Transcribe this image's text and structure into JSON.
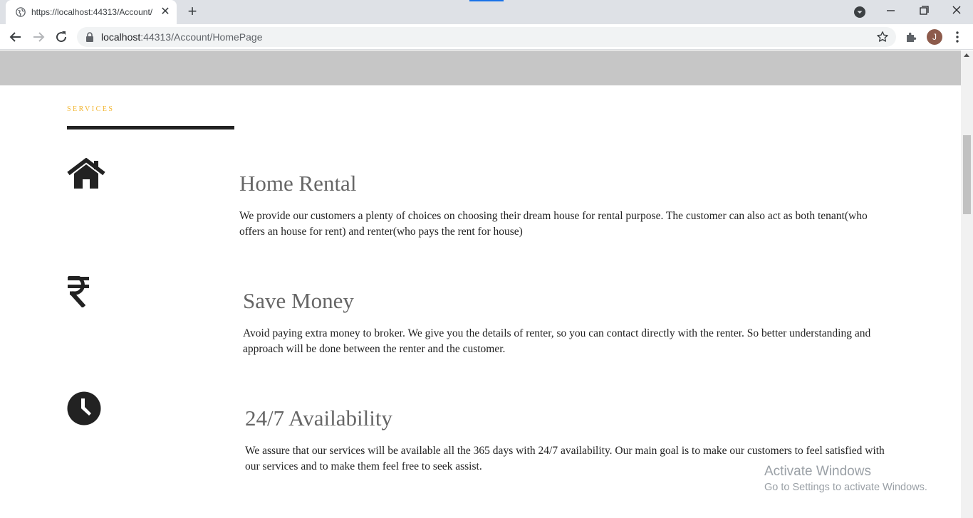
{
  "browser": {
    "tab_title": "https://localhost:44313/Account/",
    "tab_close": "✕",
    "new_tab": "+",
    "avatar_initial": "J",
    "url_host": "localhost",
    "url_rest": ":44313/Account/HomePage"
  },
  "page": {
    "section_label": "SERVICES",
    "services": [
      {
        "icon": "home-icon",
        "title": "Home Rental",
        "description": "We provide our customers a plenty of choices on choosing their dream house for rental purpose. The customer can also act as both tenant(who offers an house for rent) and renter(who pays the rent for house)"
      },
      {
        "icon": "rupee-icon",
        "title": "Save Money",
        "description": "Avoid paying extra money to broker. We give you the details of renter, so you can contact directly with the renter. So better understanding and approach will be done between the renter and the customer."
      },
      {
        "icon": "clock-icon",
        "title": "24/7 Availability",
        "description": "We assure that our services will be available all the 365 days with 24/7 availability. Our main goal is to make our customers to feel satisfied with our services and to make them feel free to seek assist."
      }
    ]
  },
  "watermark": {
    "title": "Activate Windows",
    "subtitle": "Go to Settings to activate Windows."
  },
  "colors": {
    "accent": "#f2b632",
    "hero_band": "#c6c6c6",
    "heading": "#666666",
    "text": "#222222"
  }
}
